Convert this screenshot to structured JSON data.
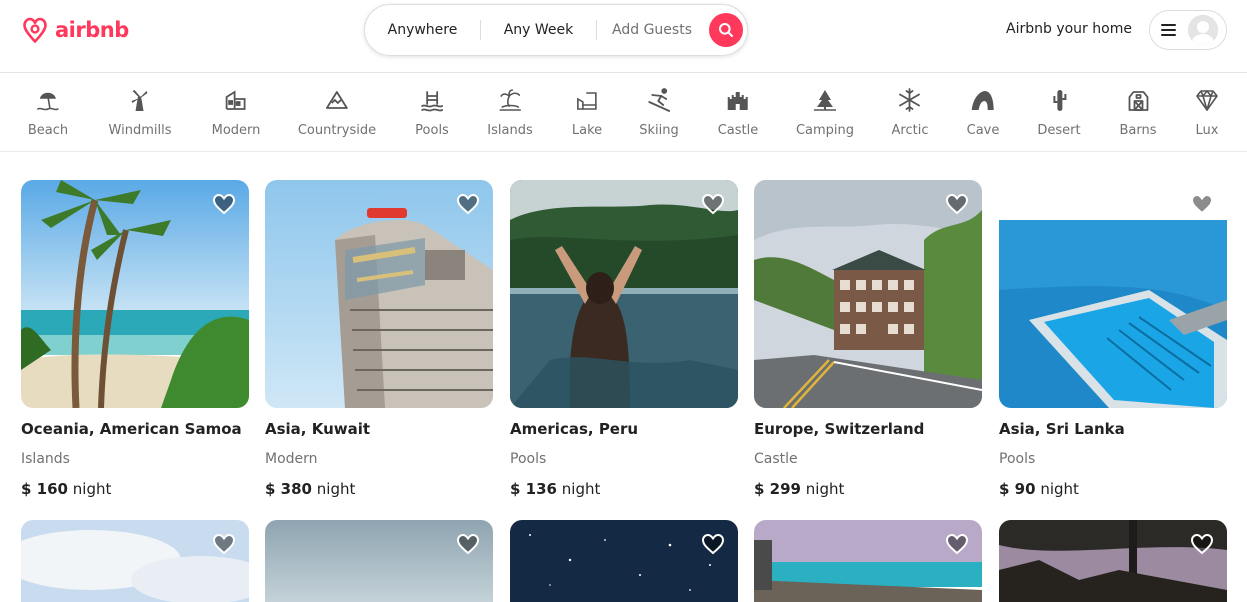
{
  "brand": {
    "name": "airbnb",
    "color": "#ff385c"
  },
  "search": {
    "where": "Anywhere",
    "when": "Any Week",
    "guests": "Add Guests"
  },
  "header": {
    "host_link": "Airbnb your home"
  },
  "categories": [
    {
      "label": "Beach",
      "icon": "beach-icon"
    },
    {
      "label": "Windmills",
      "icon": "windmill-icon"
    },
    {
      "label": "Modern",
      "icon": "modern-house-icon"
    },
    {
      "label": "Countryside",
      "icon": "countryside-icon"
    },
    {
      "label": "Pools",
      "icon": "pool-icon"
    },
    {
      "label": "Islands",
      "icon": "island-icon"
    },
    {
      "label": "Lake",
      "icon": "lake-icon"
    },
    {
      "label": "Skiing",
      "icon": "skiing-icon"
    },
    {
      "label": "Castle",
      "icon": "castle-icon"
    },
    {
      "label": "Camping",
      "icon": "camping-icon"
    },
    {
      "label": "Arctic",
      "icon": "snowflake-icon"
    },
    {
      "label": "Cave",
      "icon": "cave-icon"
    },
    {
      "label": "Desert",
      "icon": "cactus-icon"
    },
    {
      "label": "Barns",
      "icon": "barn-icon"
    },
    {
      "label": "Lux",
      "icon": "diamond-icon"
    }
  ],
  "listings": [
    {
      "location": "Oceania, American Samoa",
      "category": "Islands",
      "price": "$ 160",
      "unit": "night"
    },
    {
      "location": "Asia, Kuwait",
      "category": "Modern",
      "price": "$ 380",
      "unit": "night"
    },
    {
      "location": "Americas, Peru",
      "category": "Pools",
      "price": "$ 136",
      "unit": "night"
    },
    {
      "location": "Europe, Switzerland",
      "category": "Castle",
      "price": "$ 299",
      "unit": "night"
    },
    {
      "location": "Asia, Sri Lanka",
      "category": "Pools",
      "price": "$ 90",
      "unit": "night"
    }
  ]
}
